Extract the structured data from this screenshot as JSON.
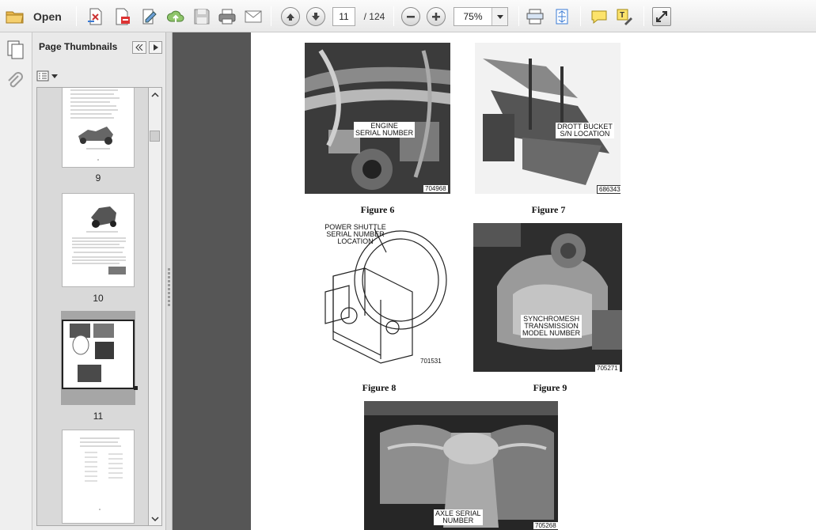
{
  "toolbar": {
    "open_label": "Open",
    "page_current": "11",
    "page_total": "/ 124",
    "zoom": "75%",
    "icons": [
      "folder-icon",
      "create-pdf-icon",
      "convert-icon",
      "edit-icon",
      "upload-icon",
      "save-icon",
      "print-icon",
      "email-icon",
      "prev-page-icon",
      "next-page-icon",
      "zoom-out-icon",
      "zoom-in-icon",
      "fit-width-icon",
      "fit-page-icon",
      "comment-icon",
      "highlight-icon",
      "expand-icon"
    ]
  },
  "sidebar": {
    "title": "Page Thumbnails",
    "thumbnails": [
      {
        "label": "9"
      },
      {
        "label": "10"
      },
      {
        "label": "11"
      },
      {
        "label": ""
      }
    ]
  },
  "document": {
    "figures": [
      {
        "caption": "Figure 6",
        "labels": [
          "ENGINE",
          "SERIAL NUMBER"
        ],
        "code": "704968"
      },
      {
        "caption": "Figure 7",
        "labels": [
          "DROTT BUCKET",
          "S/N LOCATION"
        ],
        "code": "686343"
      },
      {
        "caption": "Figure 8",
        "labels": [
          "POWER SHUTTLE",
          "SERIAL NUMBER",
          "LOCATION"
        ],
        "code": "701531"
      },
      {
        "caption": "Figure 9",
        "labels": [
          "SYNCHROMESH",
          "TRANSMISSION",
          "MODEL NUMBER"
        ],
        "code": "705271"
      },
      {
        "caption": "",
        "labels": [
          "AXLE SERIAL",
          "NUMBER"
        ],
        "code": "705268"
      }
    ]
  },
  "colors": {
    "doc_bg": "#565656",
    "panel_bg": "#e9e9e9",
    "accent": "#3a7bd5"
  }
}
